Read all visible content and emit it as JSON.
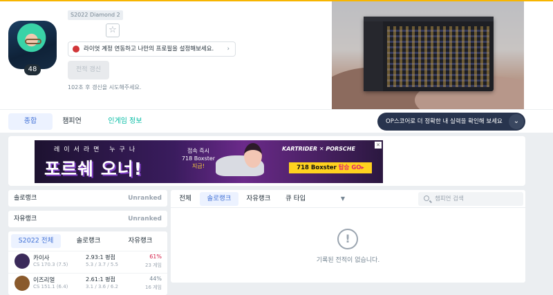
{
  "profile": {
    "level": "48",
    "season_badge": "S2022 Diamond 2",
    "riot_link_text": "라이엇 계정 연동하고 나만의 프로필을 설정해보세요.",
    "riot_link_chevron": "›",
    "favorite_icon": "☆",
    "renew_button": "전적 갱신",
    "renew_note": "102초 후 갱신을 시도해주세요."
  },
  "nav": {
    "tabs": [
      "종합",
      "챔피언",
      "인게임 정보"
    ],
    "op_banner": "OP스코어로 더 정확한 내 실력을 확인해 보세요",
    "op_chevron": "⌄"
  },
  "ad": {
    "small": "레이서라면 누구나",
    "big": "포르쉐 오너!",
    "offer_line1": "접속 즉시",
    "offer_line2": "718 Boxster",
    "offer_line3": "지급!",
    "brand": "KARTRIDER ✕ PORSCHE",
    "cta_main": "718 Boxster",
    "cta_accent": "탑승 GO▸",
    "adchoice": "✕"
  },
  "ranks": [
    {
      "label": "솔로랭크",
      "value": "Unranked"
    },
    {
      "label": "자유랭크",
      "value": "Unranked"
    }
  ],
  "champ_tabs": [
    "S2022 전체",
    "솔로랭크",
    "자유랭크"
  ],
  "champions": [
    {
      "name": "카이사",
      "cs": "CS 170.3 (7.5)",
      "kda": "2.93:1 평점",
      "kda_detail": "5.3 / 3.7 / 5.5",
      "winrate": "61%",
      "games": "23 게임",
      "color": "#3b2a5a"
    },
    {
      "name": "이즈리얼",
      "cs": "CS 151.1 (6.4)",
      "kda": "2.61:1 평점",
      "kda_detail": "3.1 / 3.6 / 6.2",
      "winrate": "44%",
      "games": "16 게임",
      "color": "#8a5a2c"
    }
  ],
  "matches": {
    "tabs": [
      "전체",
      "솔로랭크",
      "자유랭크"
    ],
    "queue_label": "큐 타입",
    "queue_caret": "▼",
    "search_placeholder": "챔피언 검색",
    "empty_icon": "!",
    "empty_text": "기록된 전적이 없습니다."
  }
}
